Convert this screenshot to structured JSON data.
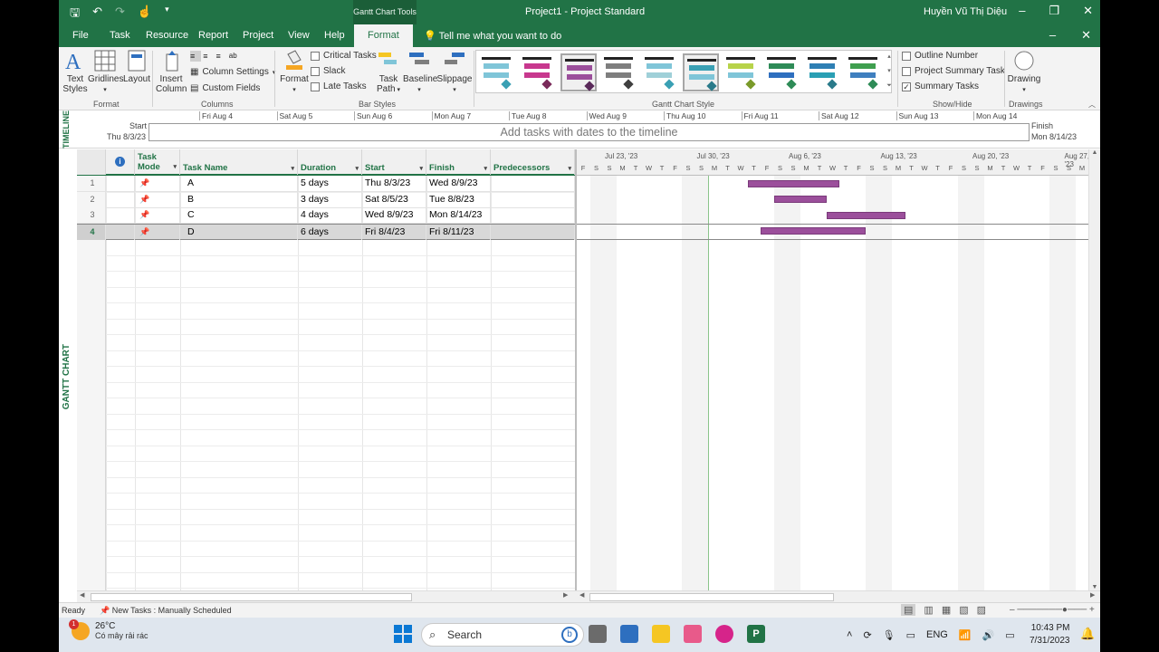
{
  "window": {
    "context_tool": "Gantt Chart Tools",
    "title": "Project1  -  Project Standard",
    "user": "Huyền Vũ Thị Diệu"
  },
  "menu": {
    "tabs": [
      "File",
      "Task",
      "Resource",
      "Report",
      "Project",
      "View",
      "Help"
    ],
    "active_tab": "Format",
    "tell_me": "Tell me what you want to do"
  },
  "ribbon": {
    "format_group": {
      "label": "Format",
      "text_styles": "Text\nStyles"
    },
    "columns_group": {
      "label": "Columns",
      "gridlines": "Gridlines",
      "layout": "Layout",
      "insert_column": "Insert\nColumn",
      "column_settings": "Column Settings",
      "custom_fields": "Custom Fields"
    },
    "bar_styles_group": {
      "label": "Bar Styles",
      "format": "Format",
      "critical_tasks": "Critical Tasks",
      "slack": "Slack",
      "late_tasks": "Late Tasks",
      "task_path": "Task\nPath",
      "baseline": "Baseline",
      "slippage": "Slippage"
    },
    "gantt_style_group": {
      "label": "Gantt Chart Style",
      "styles": [
        {
          "c1": "#7fc5d8",
          "c2": "#7fc5d8",
          "d": "#3aa0b4"
        },
        {
          "c1": "#c8388e",
          "c2": "#c8388e",
          "d": "#7a2a5a"
        },
        {
          "c1": "#9b4f9b",
          "c2": "#9b4f9b",
          "d": "#5a2a5a"
        },
        {
          "c1": "#7e7e7e",
          "c2": "#7e7e7e",
          "d": "#3f3f3f"
        },
        {
          "c1": "#7fc5d8",
          "c2": "#9fd0d8",
          "d": "#3aa0b4"
        },
        {
          "c1": "#3aa0b4",
          "c2": "#7fc5d8",
          "d": "#2a7a8a"
        },
        {
          "c1": "#b7d34a",
          "c2": "#7fc5d8",
          "d": "#7a9a2a"
        },
        {
          "c1": "#2e8b57",
          "c2": "#2e6fbf",
          "d": "#2e8b57"
        },
        {
          "c1": "#2e7fb4",
          "c2": "#2a9fb4",
          "d": "#2a7a8a"
        },
        {
          "c1": "#3f9f4f",
          "c2": "#3f7fbf",
          "d": "#2e8b57"
        }
      ],
      "selected_indices": [
        2,
        5
      ]
    },
    "show_hide_group": {
      "label": "Show/Hide",
      "outline_number": "Outline Number",
      "project_summary_task": "Project Summary Task",
      "summary_tasks": "Summary Tasks",
      "outline_number_checked": false,
      "project_summary_checked": false,
      "summary_tasks_checked": true
    },
    "drawings_group": {
      "label": "Drawings",
      "drawing": "Drawing"
    }
  },
  "timeline": {
    "side_label": "TIMELINE",
    "dates": [
      "Fri Aug 4",
      "Sat Aug 5",
      "Sun Aug 6",
      "Mon Aug 7",
      "Tue Aug 8",
      "Wed Aug 9",
      "Thu Aug 10",
      "Fri Aug 11",
      "Sat Aug 12",
      "Sun Aug 13",
      "Mon Aug 14"
    ],
    "start_label": "Start",
    "start_value": "Thu 8/3/23",
    "finish_label": "Finish",
    "finish_value": "Mon 8/14/23",
    "placeholder": "Add tasks with dates to the timeline"
  },
  "view": {
    "side_label": "GANTT CHART"
  },
  "table": {
    "headers": {
      "info": "i",
      "task_mode": "Task\nMode",
      "task_name": "Task Name",
      "duration": "Duration",
      "start": "Start",
      "finish": "Finish",
      "predecessors": "Predecessors"
    },
    "rows": [
      {
        "id": "1",
        "name": "A",
        "duration": "5 days",
        "start": "Thu 8/3/23",
        "finish": "Wed 8/9/23",
        "predecessors": ""
      },
      {
        "id": "2",
        "name": "B",
        "duration": "3 days",
        "start": "Sat 8/5/23",
        "finish": "Tue 8/8/23",
        "predecessors": ""
      },
      {
        "id": "3",
        "name": "C",
        "duration": "4 days",
        "start": "Wed 8/9/23",
        "finish": "Mon 8/14/23",
        "predecessors": ""
      },
      {
        "id": "4",
        "name": "D",
        "duration": "6 days",
        "start": "Fri 8/4/23",
        "finish": "Fri 8/11/23",
        "predecessors": ""
      }
    ],
    "selected_row": 3
  },
  "chart": {
    "weeks": [
      "Jul 23, '23",
      "Jul 30, '23",
      "Aug 6, '23",
      "Aug 13, '23",
      "Aug 20, '23",
      "Aug 27, '23"
    ],
    "day_letters": [
      "F",
      "S",
      "S",
      "M",
      "T",
      "W",
      "T",
      "F",
      "S",
      "S",
      "M",
      "T",
      "W",
      "T",
      "F",
      "S",
      "S",
      "M",
      "T",
      "W",
      "T",
      "F",
      "S",
      "S",
      "M",
      "T",
      "W",
      "T",
      "F",
      "S",
      "S",
      "M",
      "T",
      "W",
      "T",
      "F",
      "S",
      "S",
      "M"
    ],
    "bar_color": "#9b4f9b",
    "task_dates": [
      {
        "start": "2023-08-03",
        "finish": "2023-08-09"
      },
      {
        "start": "2023-08-05",
        "finish": "2023-08-08"
      },
      {
        "start": "2023-08-09",
        "finish": "2023-08-14"
      },
      {
        "start": "2023-08-04",
        "finish": "2023-08-11"
      }
    ],
    "today": "2023-07-31"
  },
  "status": {
    "ready": "Ready",
    "new_tasks": "New Tasks : Manually Scheduled"
  },
  "taskbar": {
    "weather_temp": "26°C",
    "weather_desc": "Có mây rải rác",
    "weather_badge": "1",
    "search": "Search",
    "lang": "ENG",
    "time": "10:43 PM",
    "date": "7/31/2023"
  }
}
